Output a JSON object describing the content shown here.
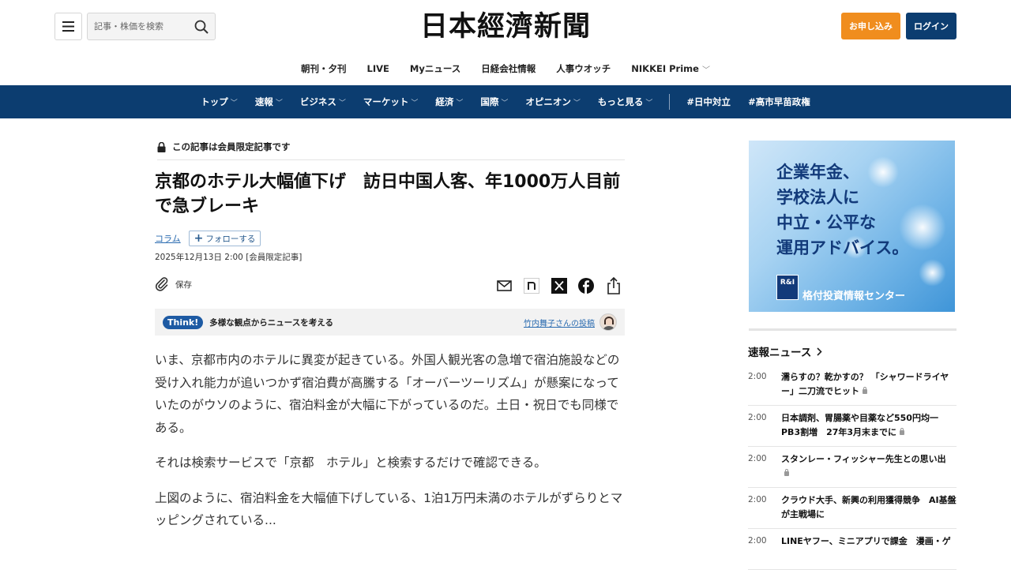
{
  "header": {
    "search_placeholder": "記事・株価を検索",
    "logo_text": "日本經濟新聞",
    "subscribe_label": "お申し込み",
    "login_label": "ログイン"
  },
  "subnav": [
    {
      "label": "朝刊・夕刊",
      "has_dropdown": false
    },
    {
      "label": "LIVE",
      "has_dropdown": false
    },
    {
      "label": "Myニュース",
      "has_dropdown": false
    },
    {
      "label": "日経会社情報",
      "has_dropdown": false
    },
    {
      "label": "人事ウオッチ",
      "has_dropdown": false
    },
    {
      "label": "NIKKEI Prime",
      "has_dropdown": true
    }
  ],
  "mainnav": {
    "items": [
      {
        "label": "トップ"
      },
      {
        "label": "速報"
      },
      {
        "label": "ビジネス"
      },
      {
        "label": "マーケット"
      },
      {
        "label": "経済"
      },
      {
        "label": "国際"
      },
      {
        "label": "オピニオン"
      },
      {
        "label": "もっと見る"
      }
    ],
    "hashtags": [
      "#日中対立",
      "#高市早苗政権"
    ]
  },
  "article": {
    "members_notice": "この記事は会員限定記事です",
    "headline": "京都のホテル大幅値下げ　訪日中国人客、年1000万人目前で急ブレーキ",
    "category": "コラム",
    "follow_label": "フォローする",
    "dateline": "2025年12月13日 2:00  [会員限定記事]",
    "save_label": "保存",
    "share_icons": [
      "mail-icon",
      "note-icon",
      "x-icon",
      "facebook-icon",
      "share-icon"
    ],
    "think": {
      "badge": "Think!",
      "text": "多様な観点からニュースを考える",
      "author_link": "竹内舞子さんの投稿"
    },
    "paragraphs": [
      "いま、京都市内のホテルに異変が起きている。外国人観光客の急増で宿泊施設などの受け入れ能力が追いつかず宿泊費が高騰する「オーバーツーリズム」が懸案になっていたのがウソのように、宿泊料金が大幅に下がっているのだ。土日・祝日でも同様である。",
      "それは検索サービスで「京都　ホテル」と検索するだけで確認できる。",
      "上図のように、宿泊料金を大幅値下げしている、1泊1万円未満のホテルがずらりとマッピングされている..."
    ]
  },
  "ad": {
    "lines": [
      "企業年金、",
      "学校法人に",
      "中立・公平な",
      "運用アドバイス。"
    ],
    "logo": "R&I",
    "brand": "格付投資情報センター"
  },
  "news": {
    "heading": "速報ニュース",
    "items": [
      {
        "time": "2:00",
        "title": "濡らすの？乾かすの？ 「シャワードライヤー」二刀流でヒット"
      },
      {
        "time": "2:00",
        "title": "日本調剤、胃腸薬や目薬など550円均一 PB3割増　27年3月末までに"
      },
      {
        "time": "2:00",
        "title": "スタンレー・フィッシャー先生との思い出"
      },
      {
        "time": "2:00",
        "title": "クラウド大手、新興の利用獲得競争　AI基盤が主戦場に"
      },
      {
        "time": "2:00",
        "title": "LINEヤフー、ミニアプリで課金　漫画・ゲ"
      }
    ]
  },
  "colors": {
    "nav_blue": "#0c3d70",
    "subscribe_orange": "#f08d1e",
    "link_blue": "#2a6bb0"
  }
}
